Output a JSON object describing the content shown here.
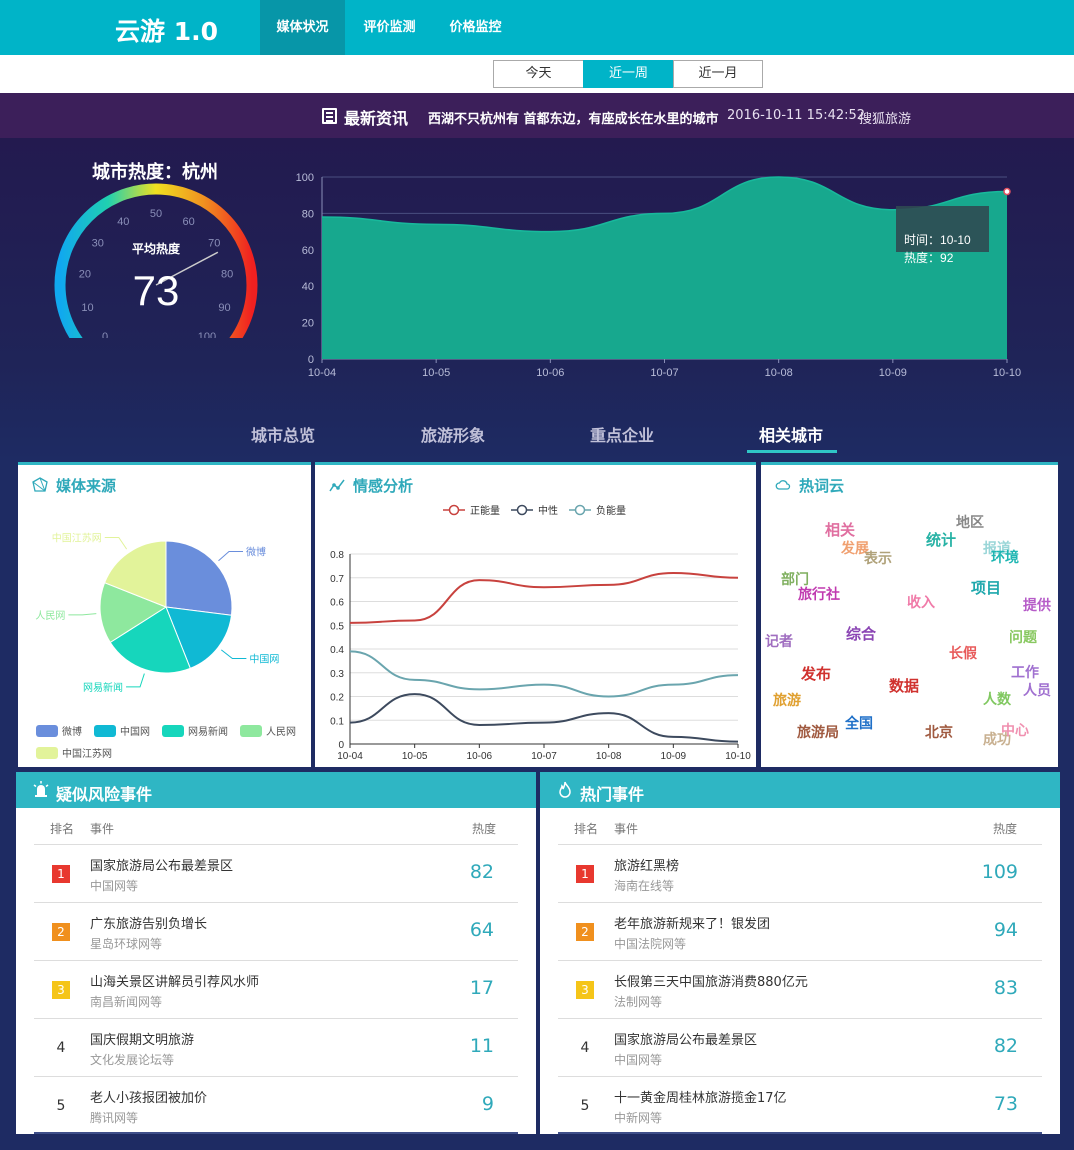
{
  "app": {
    "logo": "云游 1.0"
  },
  "nav": [
    {
      "label": "媒体状况",
      "active": true
    },
    {
      "label": "评价监测",
      "active": false
    },
    {
      "label": "价格监控",
      "active": false
    }
  ],
  "time_tabs": [
    {
      "label": "今天",
      "active": false
    },
    {
      "label": "近一周",
      "active": true
    },
    {
      "label": "近一月",
      "active": false
    }
  ],
  "news": {
    "title": "最新资讯",
    "text": "西湖不只杭州有 首都东边，有座成长在水里的城市",
    "time": "2016-10-11 15:42:52",
    "source": "搜狐旅游"
  },
  "hero": {
    "city_title": "城市热度：杭州",
    "gauge": {
      "label": "平均热度",
      "value": 73,
      "min": 0,
      "max": 100,
      "ticks": [
        "0",
        "10",
        "20",
        "30",
        "40",
        "50",
        "60",
        "70",
        "80",
        "90",
        "100"
      ]
    },
    "tooltip": {
      "time_label": "时间：",
      "time": "10-10",
      "heat_label": "热度：",
      "heat": "92"
    }
  },
  "section_tabs": [
    {
      "label": "城市总览",
      "active": false
    },
    {
      "label": "旅游形象",
      "active": false
    },
    {
      "label": "重点企业",
      "active": false
    },
    {
      "label": "相关城市",
      "active": true
    }
  ],
  "panels": {
    "media": {
      "title": "媒体来源"
    },
    "sentiment": {
      "title": "情感分析"
    },
    "cloud": {
      "title": "热词云"
    }
  },
  "chart_data": [
    {
      "type": "area",
      "x": [
        "10-04",
        "10-05",
        "10-06",
        "10-07",
        "10-08",
        "10-09",
        "10-10"
      ],
      "values": [
        78,
        74,
        70,
        80,
        100,
        82,
        92
      ],
      "ylim": [
        0,
        100
      ],
      "yticks": [
        "0",
        "20",
        "40",
        "60",
        "80",
        "100"
      ],
      "grid": true
    },
    {
      "type": "pie",
      "labels": [
        "微博",
        "中国网",
        "网易新闻",
        "人民网",
        "中国江苏网"
      ],
      "values": [
        27,
        17,
        22,
        15,
        19
      ],
      "colors": [
        "#6a8edc",
        "#10b9d4",
        "#16d6bc",
        "#8ee89e",
        "#e2f39a"
      ],
      "legend": "bottom"
    },
    {
      "type": "line",
      "x": [
        "10-04",
        "10-05",
        "10-06",
        "10-07",
        "10-08",
        "10-09",
        "10-10"
      ],
      "series": [
        {
          "name": "正能量",
          "values": [
            0.51,
            0.52,
            0.69,
            0.66,
            0.67,
            0.72,
            0.7
          ],
          "color": "#c8423e"
        },
        {
          "name": "中性",
          "values": [
            0.09,
            0.21,
            0.08,
            0.09,
            0.13,
            0.03,
            0.01
          ],
          "color": "#3d4a5e"
        },
        {
          "name": "负能量",
          "values": [
            0.39,
            0.27,
            0.23,
            0.25,
            0.2,
            0.25,
            0.29
          ],
          "color": "#6aa5ae"
        }
      ],
      "ylim": [
        0,
        0.8
      ],
      "yticks": [
        "0",
        "0.1",
        "0.2",
        "0.3",
        "0.4",
        "0.5",
        "0.6",
        "0.7",
        "0.8"
      ],
      "legend": "top",
      "grid": true
    }
  ],
  "word_cloud": [
    {
      "t": "地区",
      "c": "#888888",
      "s": 14
    },
    {
      "t": "相关",
      "c": "#e06fa0",
      "s": 15
    },
    {
      "t": "统计",
      "c": "#27b2a5",
      "s": 15
    },
    {
      "t": "发展",
      "c": "#f0a070",
      "s": 14
    },
    {
      "t": "表示",
      "c": "#b0a27a",
      "s": 14
    },
    {
      "t": "报道",
      "c": "#9ad6d8",
      "s": 14
    },
    {
      "t": "环境",
      "c": "#1fb6b2",
      "s": 14
    },
    {
      "t": "部门",
      "c": "#80b060",
      "s": 14
    },
    {
      "t": "旅行社",
      "c": "#c03ab0",
      "s": 14
    },
    {
      "t": "项目",
      "c": "#1fa8ad",
      "s": 15
    },
    {
      "t": "提供",
      "c": "#b65cc8",
      "s": 14
    },
    {
      "t": "收入",
      "c": "#f07aa8",
      "s": 14
    },
    {
      "t": "综合",
      "c": "#8b45b4",
      "s": 15
    },
    {
      "t": "记者",
      "c": "#a06ec0",
      "s": 14
    },
    {
      "t": "问题",
      "c": "#88c860",
      "s": 14
    },
    {
      "t": "长假",
      "c": "#e85a5a",
      "s": 14
    },
    {
      "t": "发布",
      "c": "#d0322f",
      "s": 15
    },
    {
      "t": "工作",
      "c": "#a070d0",
      "s": 14
    },
    {
      "t": "数据",
      "c": "#d0322f",
      "s": 15
    },
    {
      "t": "人员",
      "c": "#a070d0",
      "s": 14
    },
    {
      "t": "人数",
      "c": "#80c860",
      "s": 14
    },
    {
      "t": "旅游",
      "c": "#e0a030",
      "s": 14
    },
    {
      "t": "全国",
      "c": "#1f70c8",
      "s": 14
    },
    {
      "t": "旅游局",
      "c": "#a05a40",
      "s": 14
    },
    {
      "t": "北京",
      "c": "#a05a40",
      "s": 14
    },
    {
      "t": "成功",
      "c": "#c8b090",
      "s": 14
    },
    {
      "t": "中心",
      "c": "#f090b0",
      "s": 14
    }
  ],
  "risk_events": {
    "title": "疑似风险事件",
    "col_rank": "排名",
    "col_event": "事件",
    "col_heat": "热度",
    "rows": [
      {
        "rank": "1",
        "event": "国家旅游局公布最差景区",
        "source": "中国网等",
        "heat": "82"
      },
      {
        "rank": "2",
        "event": "广东旅游告别负增长",
        "source": "星岛环球网等",
        "heat": "64"
      },
      {
        "rank": "3",
        "event": "山海关景区讲解员引荐风水师",
        "source": "南昌新闻网等",
        "heat": "17"
      },
      {
        "rank": "4",
        "event": "国庆假期文明旅游",
        "source": "文化发展论坛等",
        "heat": "11"
      },
      {
        "rank": "5",
        "event": "老人小孩报团被加价",
        "source": "腾讯网等",
        "heat": "9"
      }
    ]
  },
  "hot_events": {
    "title": "热门事件",
    "col_rank": "排名",
    "col_event": "事件",
    "col_heat": "热度",
    "rows": [
      {
        "rank": "1",
        "event": "旅游红黑榜",
        "source": "海南在线等",
        "heat": "109"
      },
      {
        "rank": "2",
        "event": "老年旅游新规来了！银发团",
        "source": "中国法院网等",
        "heat": "94"
      },
      {
        "rank": "3",
        "event": "长假第三天中国旅游消费880亿元",
        "source": "法制网等",
        "heat": "83"
      },
      {
        "rank": "4",
        "event": "国家旅游局公布最差景区",
        "source": "中国网等",
        "heat": "82"
      },
      {
        "rank": "5",
        "event": "十一黄金周桂林旅游揽金17亿",
        "source": "中新网等",
        "heat": "73"
      }
    ]
  },
  "colors": {
    "accent": "#00b4c8",
    "rank1": "#e8382f",
    "rank2": "#f0901e",
    "rank3": "#f5c518"
  }
}
